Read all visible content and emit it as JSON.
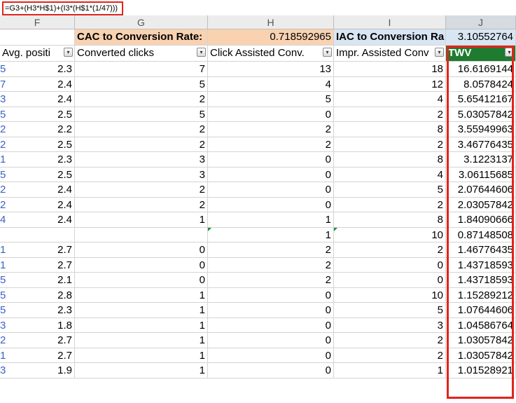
{
  "formula": "=G3+(H3*H$1)+(I3*(H$1*(1/47)))",
  "columns": [
    "F",
    "G",
    "H",
    "I",
    "J"
  ],
  "summary": {
    "cac_label": "CAC to Conversion Rate:",
    "cac_value": "0.718592965",
    "iac_label": "IAC to Conversion Ra",
    "iac_value": "3.10552764"
  },
  "headers": {
    "avg_position": "Avg. positi",
    "converted_clicks": "Converted clicks",
    "click_assisted": "Click Assisted Conv.",
    "impr_assisted": "Impr. Assisted Conv",
    "twv": "TWV"
  },
  "filter_icon": "▾",
  "rows": [
    {
      "stub": "5",
      "f": "2.3",
      "g": "7",
      "h": "13",
      "i": "18",
      "j": "16.6169144"
    },
    {
      "stub": "7",
      "f": "2.4",
      "g": "5",
      "h": "4",
      "i": "12",
      "j": "8.0578424"
    },
    {
      "stub": "3",
      "f": "2.4",
      "g": "2",
      "h": "5",
      "i": "4",
      "j": "5.65412167"
    },
    {
      "stub": "5",
      "f": "2.5",
      "g": "5",
      "h": "0",
      "i": "2",
      "j": "5.03057842"
    },
    {
      "stub": "2",
      "f": "2.2",
      "g": "2",
      "h": "2",
      "i": "8",
      "j": "3.55949963"
    },
    {
      "stub": "2",
      "f": "2.5",
      "g": "2",
      "h": "2",
      "i": "2",
      "j": "3.46776435"
    },
    {
      "stub": "1",
      "f": "2.3",
      "g": "3",
      "h": "0",
      "i": "8",
      "j": "3.1223137"
    },
    {
      "stub": "5",
      "f": "2.5",
      "g": "3",
      "h": "0",
      "i": "4",
      "j": "3.06115685"
    },
    {
      "stub": "2",
      "f": "2.4",
      "g": "2",
      "h": "0",
      "i": "5",
      "j": "2.07644606"
    },
    {
      "stub": "2",
      "f": "2.4",
      "g": "2",
      "h": "0",
      "i": "2",
      "j": "2.03057842"
    },
    {
      "stub": "4",
      "f": "2.4",
      "g": "1",
      "h": "1",
      "i": "8",
      "j": "1.84090666"
    },
    {
      "stub": "",
      "f": "",
      "g": "",
      "h": "1",
      "i": "10",
      "j": "0.87148508"
    },
    {
      "stub": "1",
      "f": "2.7",
      "g": "0",
      "h": "2",
      "i": "2",
      "j": "1.46776435"
    },
    {
      "stub": "1",
      "f": "2.7",
      "g": "0",
      "h": "2",
      "i": "0",
      "j": "1.43718593"
    },
    {
      "stub": "5",
      "f": "2.1",
      "g": "0",
      "h": "2",
      "i": "0",
      "j": "1.43718593"
    },
    {
      "stub": "5",
      "f": "2.8",
      "g": "1",
      "h": "0",
      "i": "10",
      "j": "1.15289212"
    },
    {
      "stub": "5",
      "f": "2.3",
      "g": "1",
      "h": "0",
      "i": "5",
      "j": "1.07644606"
    },
    {
      "stub": "3",
      "f": "1.8",
      "g": "1",
      "h": "0",
      "i": "3",
      "j": "1.04586764"
    },
    {
      "stub": "2",
      "f": "2.7",
      "g": "1",
      "h": "0",
      "i": "2",
      "j": "1.03057842"
    },
    {
      "stub": "1",
      "f": "2.7",
      "g": "1",
      "h": "0",
      "i": "2",
      "j": "1.03057842"
    },
    {
      "stub": "3",
      "f": "1.9",
      "g": "1",
      "h": "0",
      "i": "1",
      "j": "1.01528921"
    }
  ]
}
